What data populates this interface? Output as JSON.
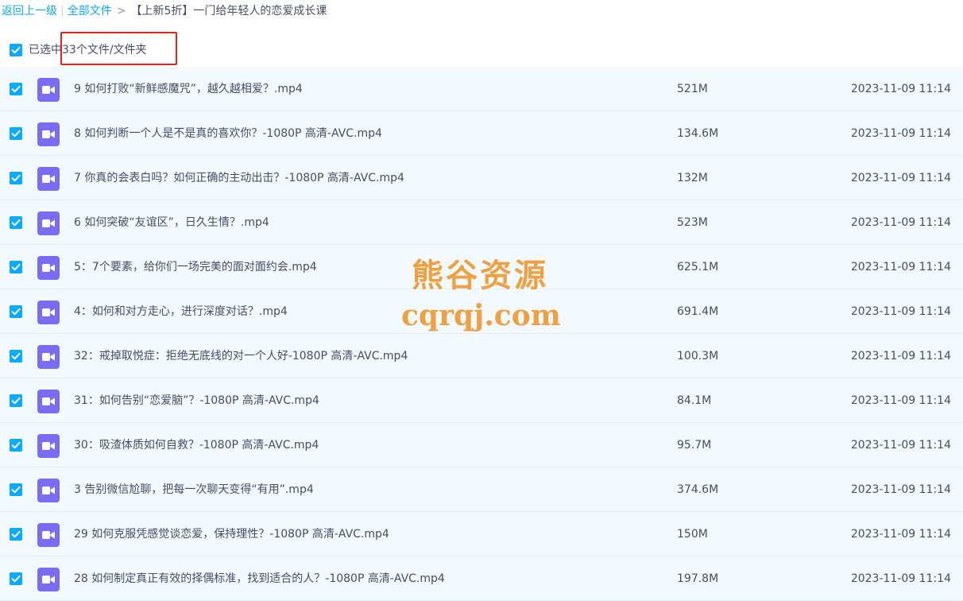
{
  "breadcrumb": {
    "back": "返回上一级",
    "all_files": "全部文件",
    "current": "【上新5折】一门给年轻人的恋爱成长课"
  },
  "selection": {
    "prefix": "已选中",
    "text": "33个文件/文件夹"
  },
  "files": [
    {
      "name": "9 如何打败“新鲜感魔咒”，越久越相爱？.mp4",
      "size": "521M",
      "time": "2023-11-09 11:14"
    },
    {
      "name": "8 如何判断一个人是不是真的喜欢你？-1080P 高清-AVC.mp4",
      "size": "134.6M",
      "time": "2023-11-09 11:14"
    },
    {
      "name": "7 你真的会表白吗？如何正确的主动出击？-1080P 高清-AVC.mp4",
      "size": "132M",
      "time": "2023-11-09 11:14"
    },
    {
      "name": "6 如何突破“友谊区”，日久生情？.mp4",
      "size": "523M",
      "time": "2023-11-09 11:14"
    },
    {
      "name": "5：7个要素，给你们一场完美的面对面约会.mp4",
      "size": "625.1M",
      "time": "2023-11-09 11:14"
    },
    {
      "name": "4：如何和对方走心，进行深度对话？.mp4",
      "size": "691.4M",
      "time": "2023-11-09 11:14"
    },
    {
      "name": "32：戒掉取悦症：拒绝无底线的对一个人好-1080P 高清-AVC.mp4",
      "size": "100.3M",
      "time": "2023-11-09 11:14"
    },
    {
      "name": "31：如何告别“恋爱脑”？-1080P 高清-AVC.mp4",
      "size": "84.1M",
      "time": "2023-11-09 11:14"
    },
    {
      "name": "30：吸渣体质如何自救？-1080P 高清-AVC.mp4",
      "size": "95.7M",
      "time": "2023-11-09 11:14"
    },
    {
      "name": "3 告别微信尬聊，把每一次聊天变得“有用”.mp4",
      "size": "374.6M",
      "time": "2023-11-09 11:14"
    },
    {
      "name": "29 如何克服凭感觉谈恋爱，保持理性？-1080P 高清-AVC.mp4",
      "size": "150M",
      "time": "2023-11-09 11:14"
    },
    {
      "name": "28 如何制定真正有效的择偶标准，找到适合的人？-1080P 高清-AVC.mp4",
      "size": "197.8M",
      "time": "2023-11-09 11:14"
    }
  ],
  "watermark": {
    "line1": "熊谷资源",
    "line2": "cqrqj.com"
  },
  "colors": {
    "accent": "#09aaff",
    "row_bg": "#f2faff",
    "video_icon": "#7b6cf6",
    "highlight": "#e8221a",
    "watermark": "#f0a040"
  }
}
